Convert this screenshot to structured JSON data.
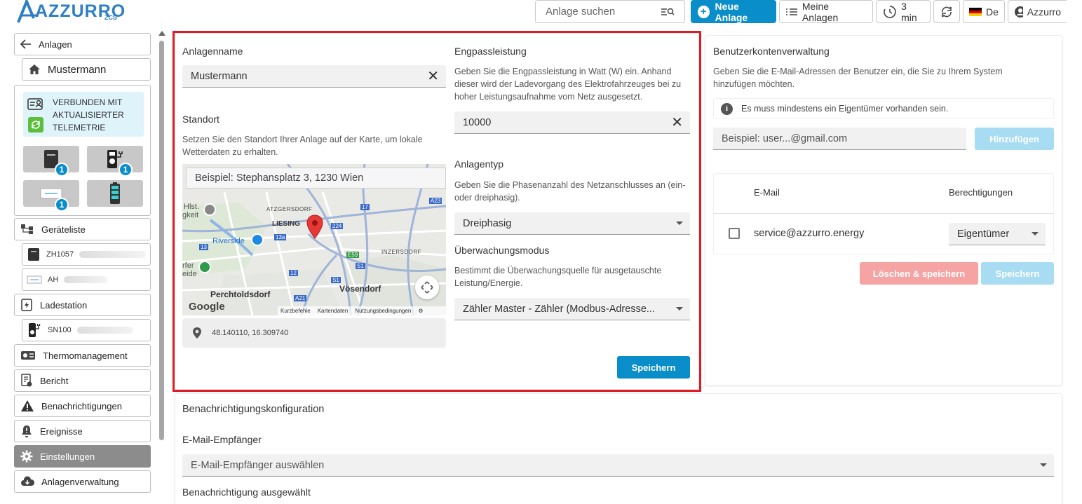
{
  "header": {
    "logo": "AZZURRO",
    "logo_sub": "ZCS",
    "search_placeholder": "Anlage suchen",
    "new_plant": "Neue Anlage",
    "my_plants": "Meine Anlagen",
    "refresh_interval": "3 min",
    "language": "De",
    "user": "Azzurro"
  },
  "sidebar": {
    "back": "Anlagen",
    "plant_name": "Mustermann",
    "status_line1": "VERBUNDEN MIT",
    "status_line2": "AKTUALISIERTER",
    "status_line3": "TELEMETRIE",
    "device_badges": [
      "1",
      "1",
      "1"
    ],
    "device_list": "Geräteliste",
    "device1": "ZH1057",
    "device2": "AH",
    "charging_station": "Ladestation",
    "device3": "SN100",
    "thermo": "Thermomanagement",
    "report": "Bericht",
    "notifications": "Benachrichtigungen",
    "events": "Ereignisse",
    "settings": "Einstellungen",
    "plant_management": "Anlagenverwaltung"
  },
  "plant": {
    "name_label": "Anlagenname",
    "name_value": "Mustermann",
    "location_label": "Standort",
    "location_desc": "Setzen Sie den Standort Ihrer Anlage auf der Karte, um lokale Wetterdaten zu erhalten.",
    "address_placeholder": "Beispiel: Stephansplatz 3, 1230 Wien",
    "coordinates": "48.140110, 16.309740",
    "peak_label": "Engpassleistung",
    "peak_desc": "Geben Sie die Engpassleistung in Watt (W) ein. Anhand dieser wird der Ladevorgang des Elektrofahrzeuges bei zu hoher Leistungsaufnahme vom Netz ausgesetzt.",
    "peak_value": "10000",
    "type_label": "Anlagentyp",
    "type_desc": "Geben Sie die Phasenanzahl des Netzanschlusses an (ein- oder dreiphasig).",
    "type_value": "Dreiphasig",
    "monitor_label": "Überwachungsmodus",
    "monitor_desc": "Bestimmt die Überwachungsquelle für ausgetauschte Leistung/Energie.",
    "monitor_value": "Zähler Master - Zähler (Modbus-Adresse...",
    "save": "Speichern"
  },
  "map": {
    "labels": {
      "hlst": "Hlst.",
      "gkeit": "gkeit",
      "atzgersdorf": "ATZGERSDORF",
      "liesing": "LIESING",
      "riverside": "Riverside",
      "inzersdorf": "INZERSDORF",
      "erfer": "rfer",
      "eide": "eide",
      "perchtoldsdorf": "Perchtoldsdorf",
      "voesendorf": "Vösendorf"
    },
    "roads": [
      "A23",
      "17",
      "224",
      "13a",
      "13",
      "E59",
      "S1",
      "12",
      "S1",
      "A21"
    ],
    "google": "Google",
    "shortcuts": "Kurzbefehle",
    "map_data": "Kartendaten",
    "terms": "Nutzungsbedingungen"
  },
  "accounts": {
    "title": "Benutzerkontenverwaltung",
    "desc": "Geben Sie die E-Mail-Adressen der Benutzer ein, die Sie zu Ihrem System hinzufügen möchten.",
    "info": "Es muss mindestens ein Eigentümer vorhanden sein.",
    "email_placeholder": "Beispiel: user...@gmail.com",
    "add": "Hinzufügen",
    "col_email": "E-Mail",
    "col_permissions": "Berechtigungen",
    "row_email": "service@azzurro.energy",
    "row_permission": "Eigentümer",
    "delete_save": "Löschen & speichern",
    "save": "Speichern"
  },
  "notifications": {
    "title": "Benachrichtigungskonfiguration",
    "recipients_label": "E-Mail-Empfänger",
    "recipients_placeholder": "E-Mail-Empfänger auswählen",
    "selected_label": "Benachrichtigung ausgewählt"
  },
  "colors": {
    "primary": "#0a8ec9",
    "highlight": "#e01b24",
    "disabled_blue": "#a7dcf2",
    "disabled_red": "#f5a3a3"
  }
}
